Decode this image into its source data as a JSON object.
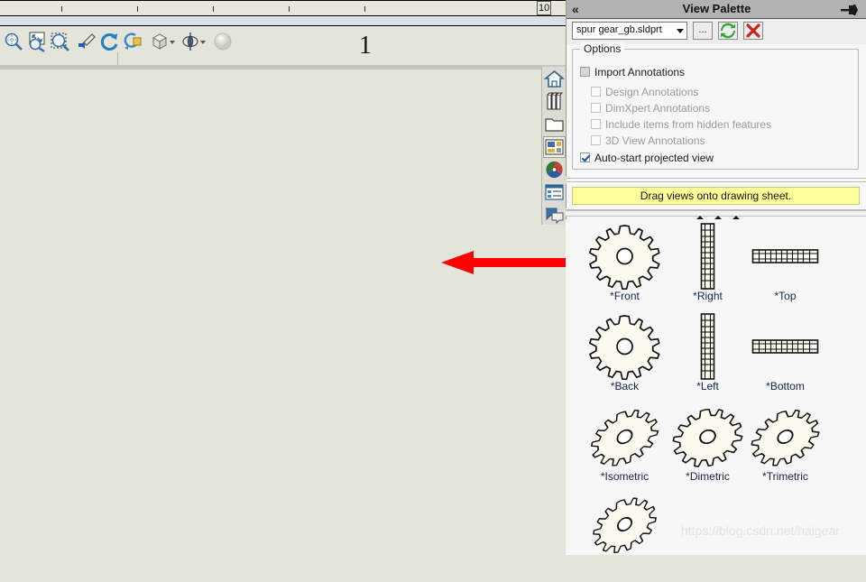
{
  "window": {
    "collapse_icon": "«",
    "title": "View Palette",
    "pin_icon": "pushpin-horizontal"
  },
  "doc_toolbar": {
    "document_name": "spur gear_gb.sldprt",
    "browse_label": "...",
    "refresh_icon": "refresh-icon",
    "close_icon": "close-x-icon"
  },
  "options": {
    "legend": "Options",
    "items": [
      {
        "label": "Import Annotations",
        "checked": false,
        "enabled": true,
        "indent": 0
      },
      {
        "label": "Design Annotations",
        "checked": false,
        "enabled": false,
        "indent": 1
      },
      {
        "label": "DimXpert Annotations",
        "checked": false,
        "enabled": false,
        "indent": 1
      },
      {
        "label": "Include items from hidden features",
        "checked": false,
        "enabled": false,
        "indent": 1
      },
      {
        "label": "3D View Annotations",
        "checked": false,
        "enabled": false,
        "indent": 1
      },
      {
        "label": "Auto-start projected view",
        "checked": true,
        "enabled": true,
        "indent": 0
      }
    ]
  },
  "banner": {
    "text": "Drag views onto drawing sheet."
  },
  "views": [
    {
      "label": "*Front",
      "art": "gear-face"
    },
    {
      "label": "*Right",
      "art": "gear-edge-vertical"
    },
    {
      "label": "*Top",
      "art": "gear-edge-horizontal"
    },
    {
      "label": "*Back",
      "art": "gear-face"
    },
    {
      "label": "*Left",
      "art": "gear-edge-vertical"
    },
    {
      "label": "*Bottom",
      "art": "gear-edge-horizontal"
    },
    {
      "label": "*Isometric",
      "art": "gear-iso"
    },
    {
      "label": "*Dimetric",
      "art": "gear-iso"
    },
    {
      "label": "*Trimetric",
      "art": "gear-iso"
    },
    {
      "label": "",
      "art": "gear-iso"
    }
  ],
  "task_pane_icons": [
    {
      "name": "home-icon",
      "selected": false
    },
    {
      "name": "design-library-icon",
      "selected": false
    },
    {
      "name": "file-explorer-icon",
      "selected": false
    },
    {
      "name": "view-palette-icon",
      "selected": true
    },
    {
      "name": "appearances-icon",
      "selected": false
    },
    {
      "name": "custom-properties-icon",
      "selected": false
    },
    {
      "name": "solidworks-forum-icon",
      "selected": false
    }
  ],
  "view_toolbar_icons": [
    "zoom-to-fit-icon",
    "zoom-to-area-icon",
    "zoom-in-out-icon",
    "previous-view-icon",
    "rotate-view-icon",
    "pan-icon",
    "view-orientation-icon",
    "display-style-icon",
    "appearance-sphere-icon"
  ],
  "drawing": {
    "sheet_number": "1",
    "ruler_label": "10"
  },
  "annotation": {
    "arrow_color": "#ff0000",
    "direction": "left"
  },
  "watermark": {
    "text": "https://blog.csdn.net/haigear"
  },
  "colors": {
    "drawing_bg": "#e3e4da",
    "panel_bg": "#f7f7f7",
    "titlebar": "#b2b2b2",
    "banner": "#ffff99",
    "label": "#15224a"
  }
}
